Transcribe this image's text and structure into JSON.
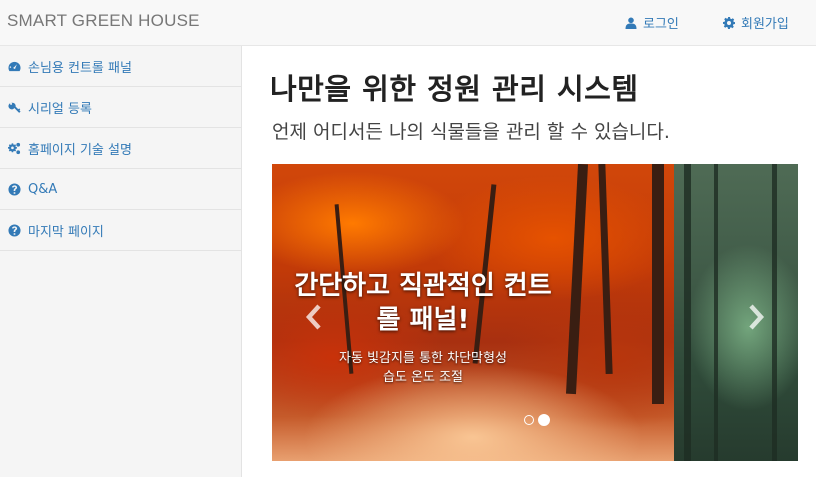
{
  "navbar": {
    "brand": "SMART GREEN HOUSE",
    "login_label": "로그인",
    "signup_label": "회원가입"
  },
  "sidebar": {
    "items": [
      {
        "label": "손님용 컨트롤 패널",
        "icon": "dashboard-icon"
      },
      {
        "label": "시리얼 등록",
        "icon": "key-icon"
      },
      {
        "label": "홈페이지 기술 설명",
        "icon": "gears-icon"
      },
      {
        "label": "Q&A",
        "icon": "question-circle-icon"
      },
      {
        "label": "마지막 페이지",
        "icon": "question-circle-icon"
      }
    ]
  },
  "main": {
    "title": "나만을 위한 정원 관리 시스템",
    "subtitle": "언제 어디서든 나의 식물들을 관리 할 수 있습니다."
  },
  "carousel": {
    "caption_title_line1": "간단하고 직관적인 컨트",
    "caption_title_line2": "롤 패널!",
    "caption_sub_line1": "자동 빛감지를 통한 차단막형성",
    "caption_sub_line2": "습도 온도 조절",
    "indicator_count": 2,
    "active_index": 1
  },
  "colors": {
    "link": "#337ab7",
    "navbar_bg": "#f8f8f8",
    "sidebar_bg": "#f5f5f5"
  }
}
